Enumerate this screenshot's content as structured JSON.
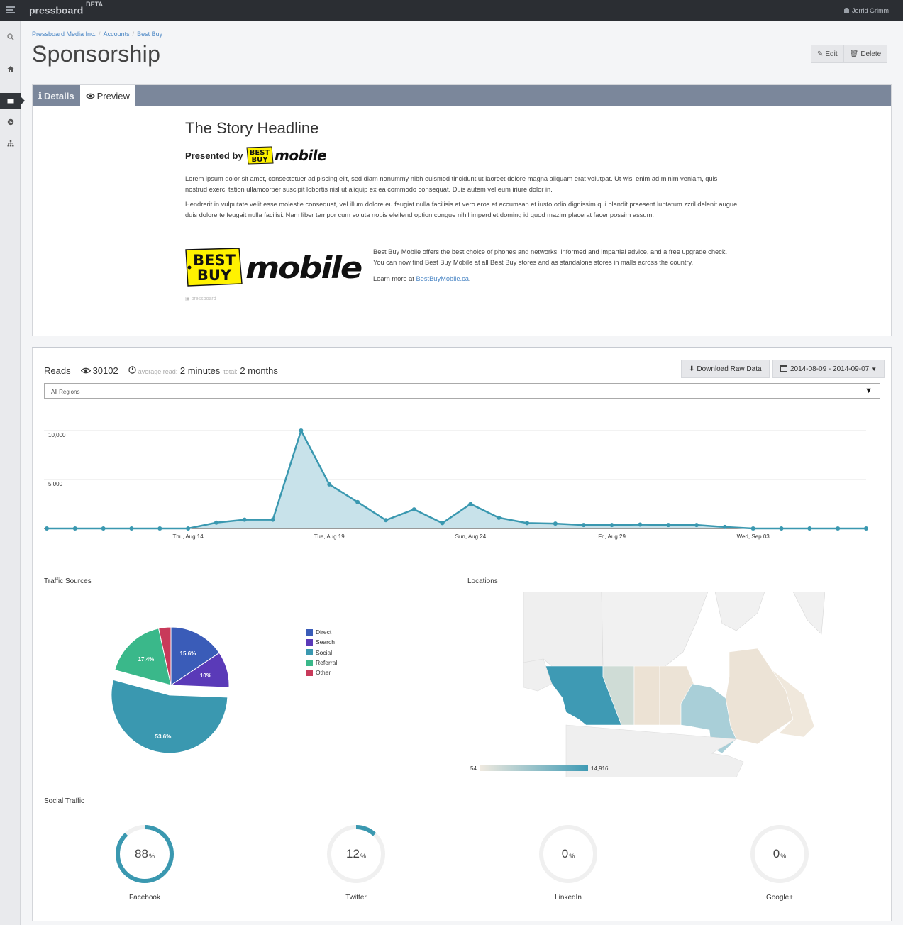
{
  "app": {
    "brand": "pressboard",
    "brand_tag": "BETA",
    "user_name": "Jerrid Grimm"
  },
  "sidebar": {
    "items": [
      {
        "icon": "search-icon"
      },
      {
        "icon": "home-icon"
      },
      {
        "icon": "folder-icon",
        "active": true
      },
      {
        "icon": "globe-icon"
      },
      {
        "icon": "sitemap-icon"
      }
    ]
  },
  "breadcrumb": [
    "Pressboard Media Inc.",
    "Accounts",
    "Best Buy"
  ],
  "page": {
    "title": "Sponsorship",
    "edit_label": "Edit",
    "delete_label": "Delete"
  },
  "tabs": {
    "details_label": "Details",
    "preview_label": "Preview"
  },
  "preview": {
    "headline": "The Story Headline",
    "presented_by": "Presented by",
    "logo_best": "BEST",
    "logo_buy": "BUY",
    "logo_mobile": "mobile",
    "paragraph1": "Lorem ipsum dolor sit amet, consectetuer adipiscing elit, sed diam nonummy nibh euismod tincidunt ut laoreet dolore magna aliquam erat volutpat. Ut wisi enim ad minim veniam, quis nostrud exerci tation ullamcorper suscipit lobortis nisl ut aliquip ex ea commodo consequat. Duis autem vel eum iriure dolor in.",
    "paragraph2": "Hendrerit in vulputate velit esse molestie consequat, vel illum dolore eu feugiat nulla facilisis at vero eros et accumsan et iusto odio dignissim qui blandit praesent luptatum zzril delenit augue duis dolore te feugait nulla facilisi. Nam liber tempor cum soluta nobis eleifend option congue nihil imperdiet doming id quod mazim placerat facer possim assum.",
    "sponsor_text": "Best Buy Mobile offers the best choice of phones and networks, informed and impartial advice, and a free upgrade check. You can now find Best Buy Mobile at all Best Buy stores and as standalone stores in malls across the country.",
    "learn_more_prefix": "Learn more at",
    "learn_more_link": "BestBuyMobile.ca",
    "learn_more_suffix": ".",
    "pressboard_mark": "pressboard"
  },
  "stats": {
    "reads_label": "Reads",
    "reads_count": "30102",
    "average_read_label": "average read:",
    "average_read_value": "2 minutes",
    "total_label": ", total:",
    "total_value": "2 months",
    "download_label": "Download Raw Data",
    "date_range": "2014-08-09 - 2014-09-07",
    "region_value": "All Regions",
    "traffic_sources_title": "Traffic Sources",
    "locations_title": "Locations",
    "social_traffic_title": "Social Traffic",
    "scale_min": "54",
    "scale_max": "14,916"
  },
  "colors": {
    "accent": "#3a98b0",
    "area_fill": "#c8e2ea",
    "direct": "#3a5cb8",
    "search": "#5a3ab8",
    "social": "#3a98b0",
    "referral": "#3ab88a",
    "other": "#c83a5a"
  },
  "chart_data": [
    {
      "type": "area",
      "title": "",
      "x": [
        "2014-08-09",
        "2014-08-10",
        "2014-08-11",
        "2014-08-12",
        "2014-08-13",
        "2014-08-14",
        "2014-08-15",
        "2014-08-16",
        "2014-08-17",
        "2014-08-18",
        "2014-08-19",
        "2014-08-20",
        "2014-08-21",
        "2014-08-22",
        "2014-08-23",
        "2014-08-24",
        "2014-08-25",
        "2014-08-26",
        "2014-08-27",
        "2014-08-28",
        "2014-08-29",
        "2014-08-30",
        "2014-08-31",
        "2014-09-01",
        "2014-09-02",
        "2014-09-03",
        "2014-09-04",
        "2014-09-05",
        "2014-09-06",
        "2014-09-07"
      ],
      "values": [
        0,
        0,
        0,
        0,
        0,
        0,
        600,
        900,
        900,
        10000,
        4500,
        2700,
        850,
        1950,
        550,
        2500,
        1100,
        550,
        500,
        350,
        350,
        400,
        350,
        350,
        150,
        0,
        0,
        0,
        0,
        0
      ],
      "tick_labels": [
        "...",
        "Thu, Aug 14",
        "Tue, Aug 19",
        "Sun, Aug 24",
        "Fri, Aug 29",
        "Wed, Sep 03"
      ],
      "y_ticks": [
        "5,000",
        "10,000"
      ],
      "ylim": [
        0,
        10000
      ],
      "grid": true
    },
    {
      "type": "pie",
      "title": "Traffic Sources",
      "categories": [
        "Direct",
        "Search",
        "Social",
        "Referral",
        "Other"
      ],
      "values": [
        15.6,
        10,
        53.6,
        17.4,
        3.4
      ],
      "value_labels": [
        "15.6%",
        "10%",
        "53.6%",
        "17.4%",
        ""
      ],
      "legend_position": "right"
    },
    {
      "type": "donut",
      "title": "Social Traffic",
      "categories": [
        "Facebook",
        "Twitter",
        "LinkedIn",
        "Google+"
      ],
      "values": [
        88,
        12,
        0,
        0
      ],
      "unit": "%"
    }
  ]
}
